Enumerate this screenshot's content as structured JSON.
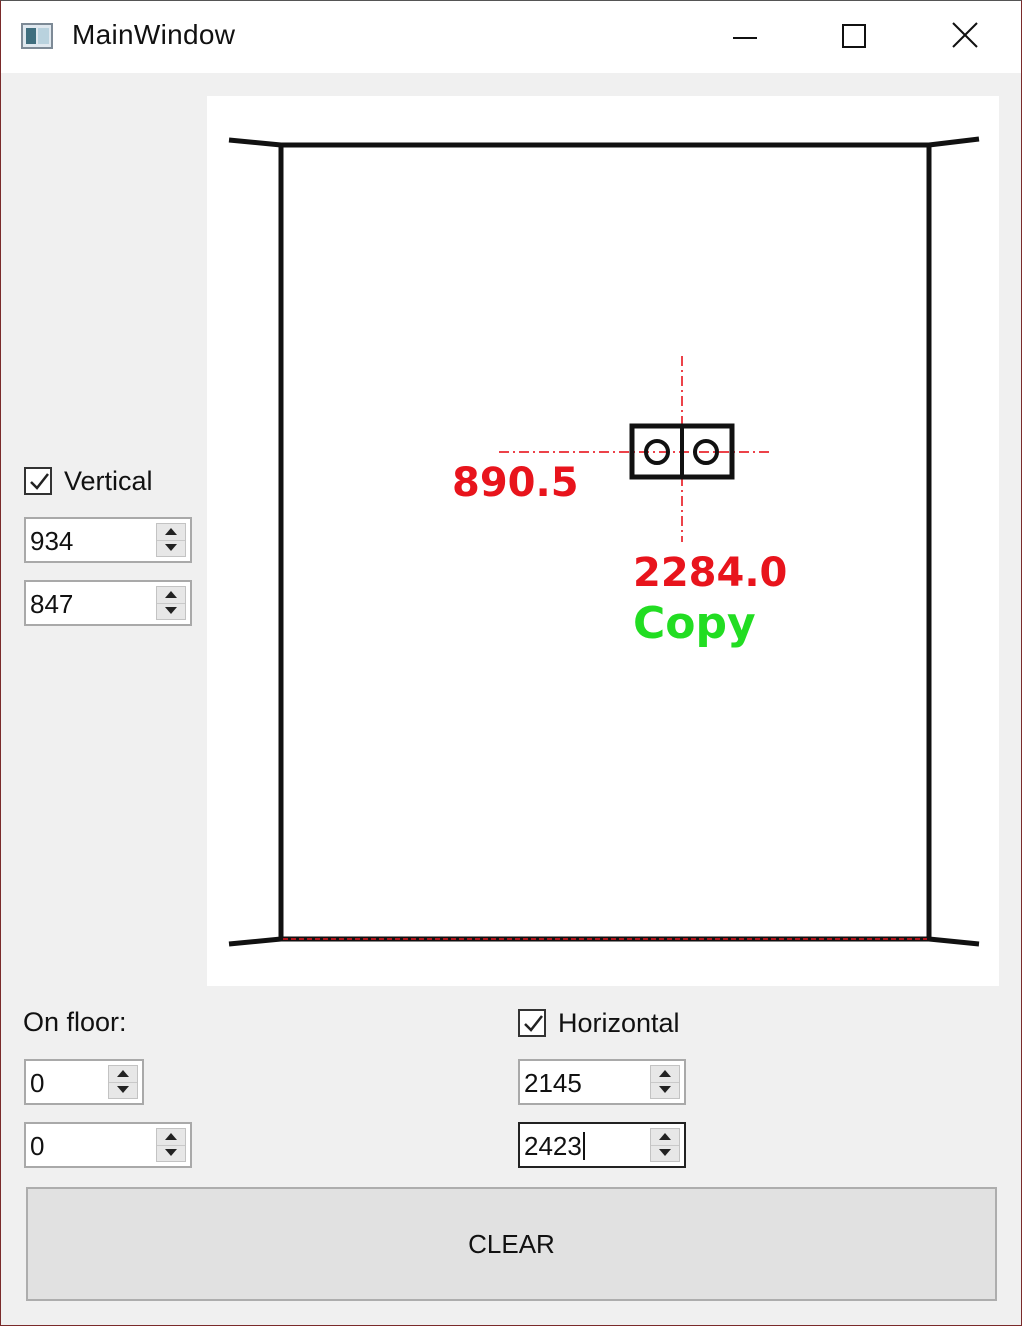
{
  "window": {
    "title": "MainWindow"
  },
  "icons": {
    "app": "app-window-icon",
    "minimize": "minimize-icon",
    "maximize": "maximize-icon",
    "close": "close-icon",
    "check": "checkmark-icon",
    "spin_up": "arrow-up-icon",
    "spin_down": "arrow-down-icon"
  },
  "canvas": {
    "vertical_dimension_label": "890.5",
    "horizontal_dimension_label": "2284.0",
    "status_label": "Copy"
  },
  "vertical": {
    "label": "Vertical",
    "checked": true,
    "value_1": "934",
    "value_2": "847"
  },
  "on_floor": {
    "label": "On floor:",
    "value_1": "0",
    "value_2": "0"
  },
  "horizontal": {
    "label": "Horizontal",
    "checked": true,
    "value_1": "2145",
    "value_2": "2423"
  },
  "clear_button": {
    "label": "CLEAR"
  },
  "colors": {
    "dimension_text": "#e8141c",
    "status_text": "#22dd22",
    "guide_line": "#e8141c",
    "window_bg": "#f0f0f0",
    "canvas_bg": "#ffffff"
  }
}
